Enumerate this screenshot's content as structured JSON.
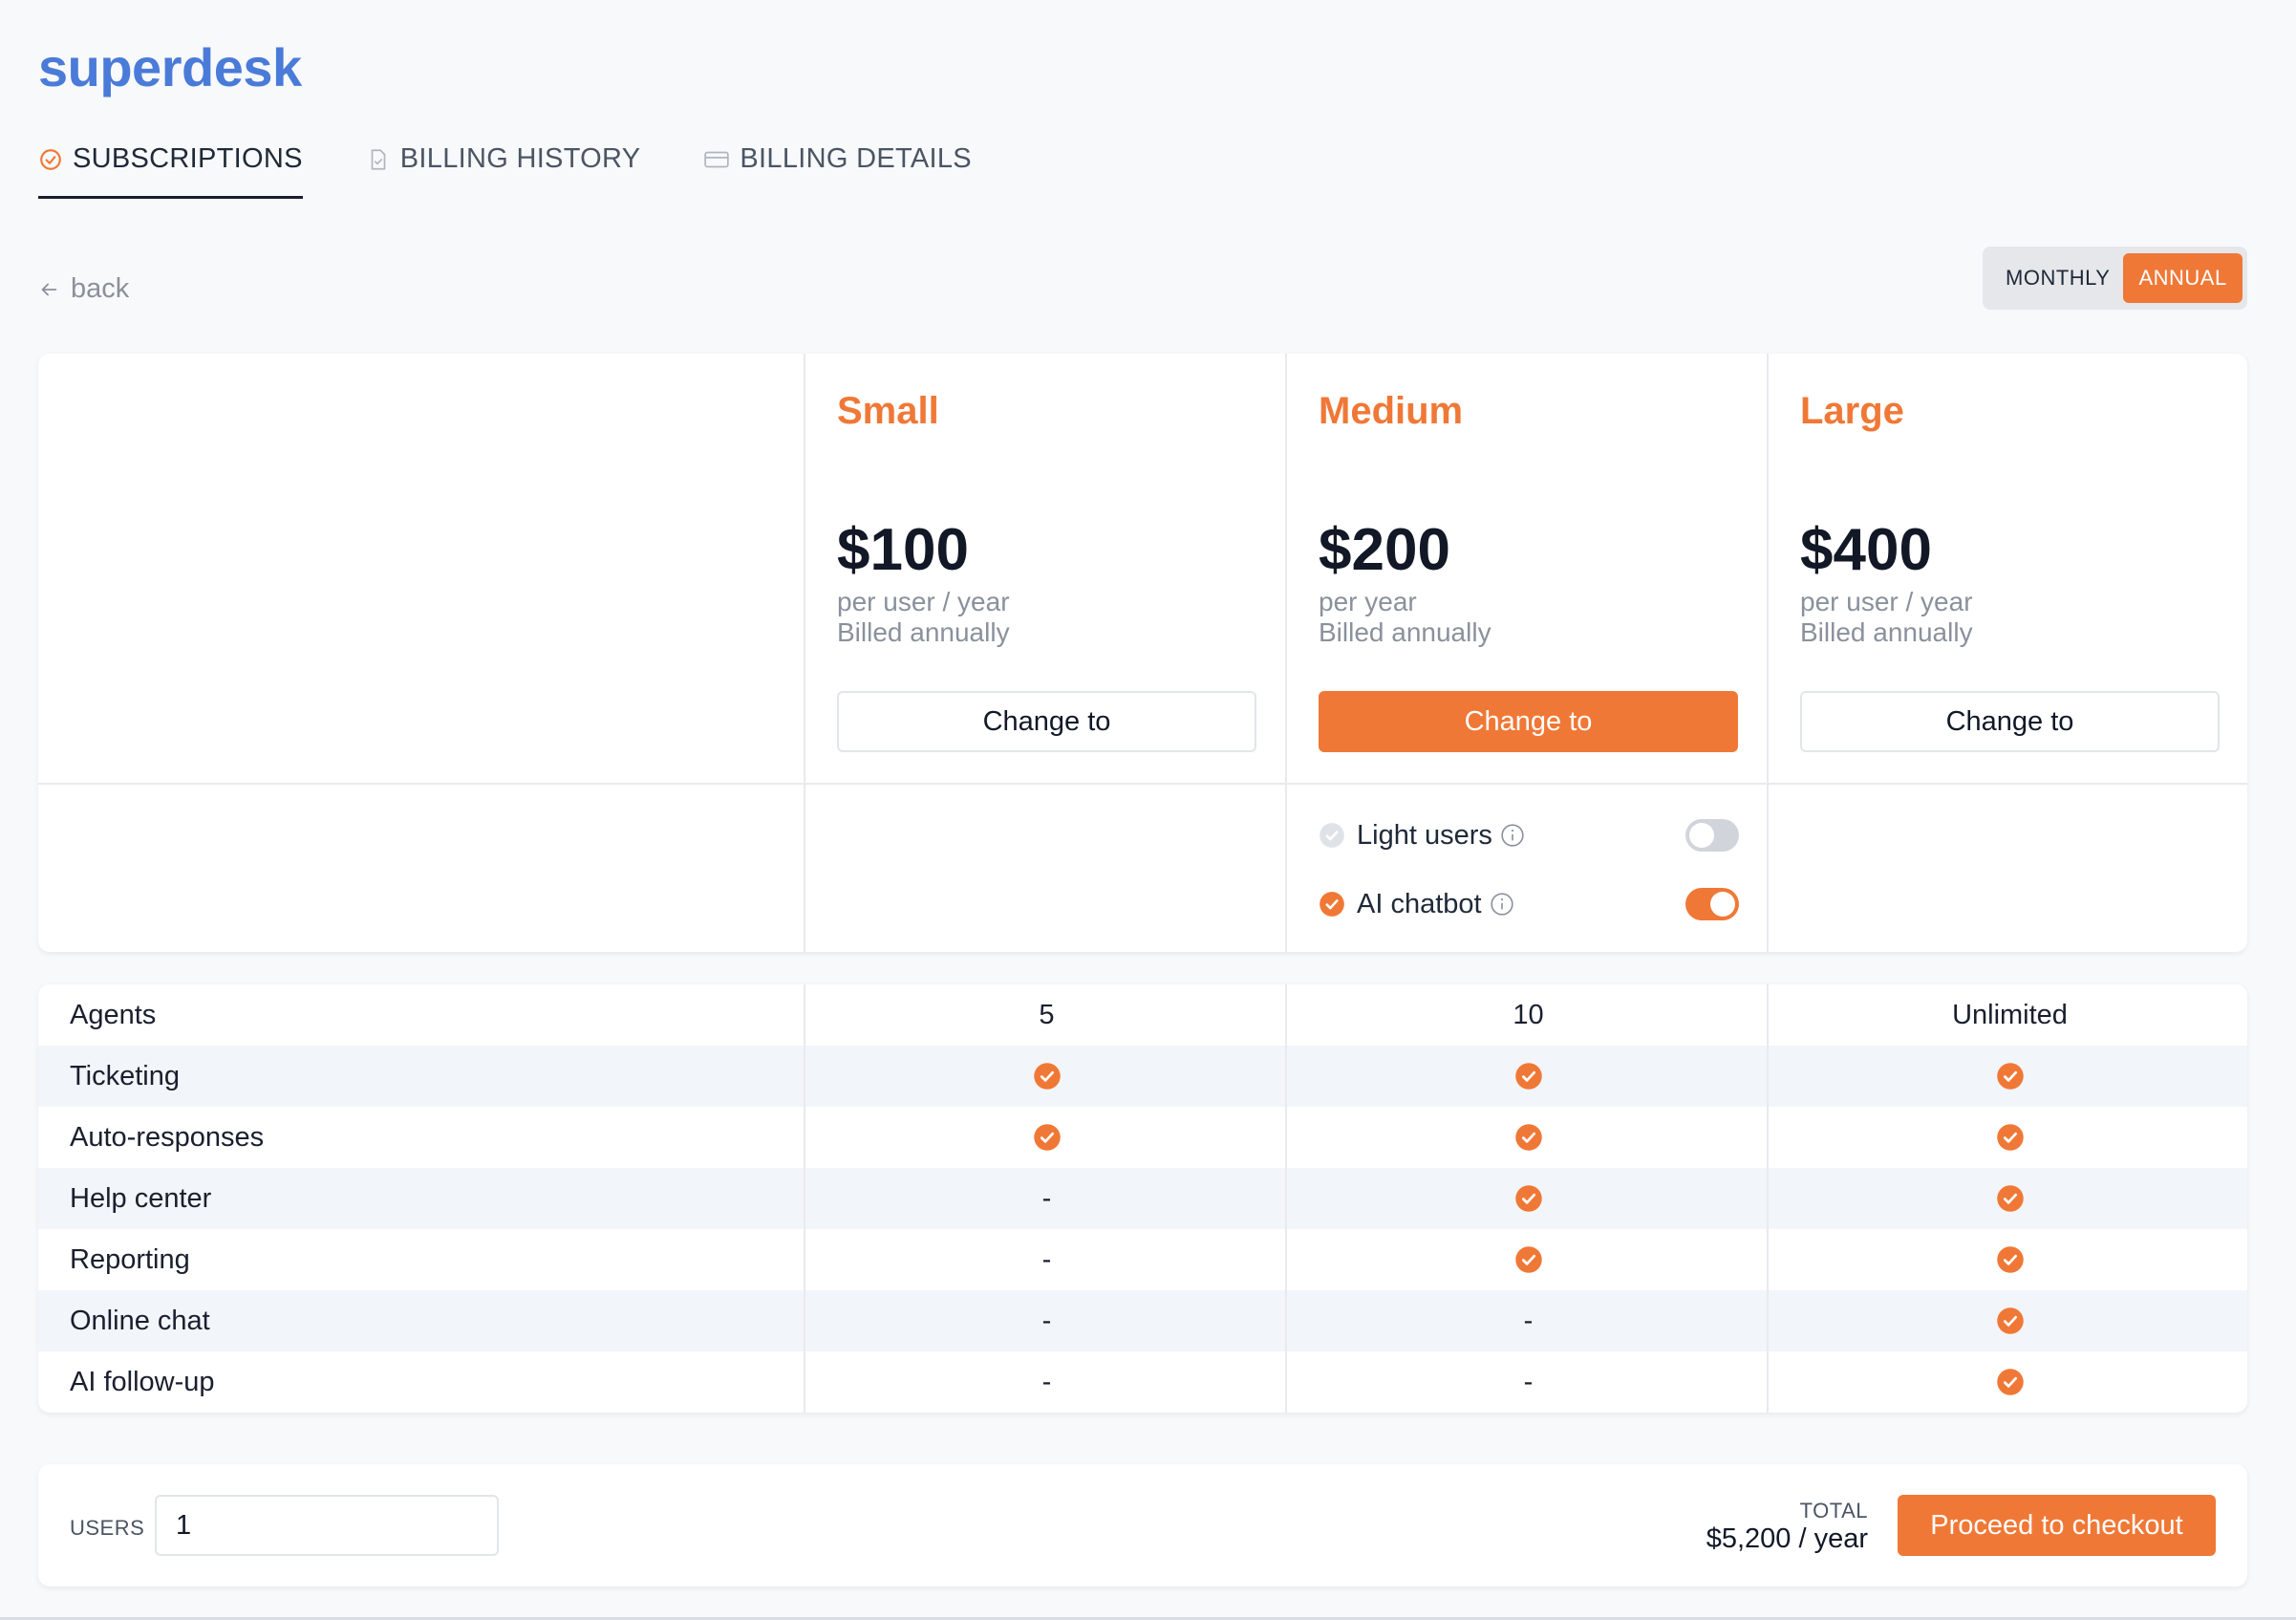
{
  "app": {
    "name": "superdesk"
  },
  "tabs": [
    {
      "label": "SUBSCRIPTIONS",
      "icon": "check-circle-icon",
      "active": true
    },
    {
      "label": "BILLING HISTORY",
      "icon": "document-check-icon",
      "active": false
    },
    {
      "label": "BILLING DETAILS",
      "icon": "credit-card-icon",
      "active": false
    }
  ],
  "back": {
    "label": "back",
    "icon": "arrow-left-icon"
  },
  "period": {
    "monthly": "MONTHLY",
    "annual": "ANNUAL",
    "selected": "ANNUAL"
  },
  "plans": [
    {
      "name": "Small",
      "price": "$100",
      "unit": "per user / year",
      "billed": "Billed annually",
      "button": "Change to",
      "primary": false
    },
    {
      "name": "Medium",
      "price": "$200",
      "unit": "per year",
      "billed": "Billed annually",
      "button": "Change to",
      "primary": true
    },
    {
      "name": "Large",
      "price": "$400",
      "unit": "per user / year",
      "billed": "Billed annually",
      "button": "Change to",
      "primary": false
    }
  ],
  "addons": [
    {
      "label": "Light users",
      "enabled": false,
      "icon": "info-icon"
    },
    {
      "label": "AI chatbot",
      "enabled": true,
      "icon": "info-icon"
    }
  ],
  "features": [
    {
      "name": "Agents",
      "values": [
        "5",
        "10",
        "Unlimited"
      ]
    },
    {
      "name": "Ticketing",
      "values": [
        "check",
        "check",
        "check"
      ]
    },
    {
      "name": "Auto-responses",
      "values": [
        "check",
        "check",
        "check"
      ]
    },
    {
      "name": "Help center",
      "values": [
        "-",
        "check",
        "check"
      ]
    },
    {
      "name": "Reporting",
      "values": [
        "-",
        "check",
        "check"
      ]
    },
    {
      "name": "Online chat",
      "values": [
        "-",
        "-",
        "check"
      ]
    },
    {
      "name": "AI follow-up",
      "values": [
        "-",
        "-",
        "check"
      ]
    }
  ],
  "checkout": {
    "users_label": "USERS",
    "users_value": "1",
    "total_label": "TOTAL",
    "total_value": "$5,200 / year",
    "button": "Proceed to checkout"
  },
  "colors": {
    "accent": "#f07836",
    "brand": "#4a7bd8",
    "text": "#1a1f2e",
    "muted": "#8a919c"
  }
}
